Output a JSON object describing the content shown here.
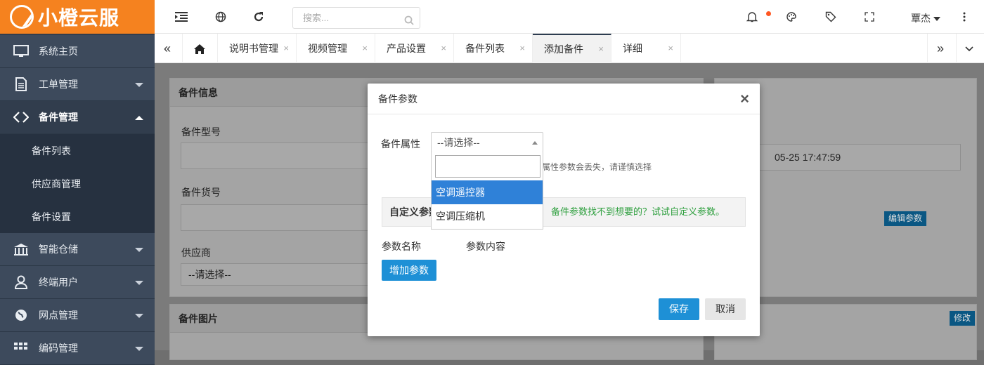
{
  "app": {
    "brand": "小橙云服"
  },
  "sidebar": {
    "items": [
      {
        "label": "系统主页",
        "icon": "monitor-icon"
      },
      {
        "label": "工单管理",
        "icon": "document-icon"
      },
      {
        "label": "备件管理",
        "icon": "parts-icon"
      },
      {
        "label": "智能仓储",
        "icon": "warehouse-icon"
      },
      {
        "label": "终端用户",
        "icon": "user-icon"
      },
      {
        "label": "网点管理",
        "icon": "globe-icon"
      },
      {
        "label": "编码管理",
        "icon": "grid-icon"
      }
    ],
    "subitems": [
      "备件列表",
      "供应商管理",
      "备件设置"
    ]
  },
  "topbar": {
    "search_placeholder": "搜索...",
    "user": "覃杰"
  },
  "tabs": [
    {
      "label": "说明书管理"
    },
    {
      "label": "视频管理"
    },
    {
      "label": "产品设置"
    },
    {
      "label": "备件列表"
    },
    {
      "label": "添加备件"
    },
    {
      "label": "详细"
    }
  ],
  "tab_close": "×",
  "background": {
    "panel_title": "备件信息",
    "label_model": "备件型号",
    "label_sku": "备件货号",
    "label_supplier": "供应商",
    "supplier_value": "--请选择--",
    "date_value": "05-25 17:47:59",
    "edit_params": "编辑参数",
    "panel2_title": "备件图片",
    "modify": "修改"
  },
  "modal": {
    "title": "备件参数",
    "close": "×",
    "attr_label": "备件属性",
    "select_value": "--请选择--",
    "options": [
      "空调遥控器",
      "空调压缩机"
    ],
    "hint": "属性参数会丢失，请谨慎选择",
    "custom_label": "自定义参数",
    "custom_hint": "备件参数找不到想要的？试试自定义参数。",
    "col_name": "参数名称",
    "col_content": "参数内容",
    "add_button": "增加参数",
    "save_button": "保存",
    "cancel_button": "取消"
  },
  "colors": {
    "brand": "#f5821f",
    "sidebar": "#313d4d",
    "primary": "#1e90d6",
    "selected_option": "#2f81d8",
    "green_hint": "#2e9f3e"
  }
}
